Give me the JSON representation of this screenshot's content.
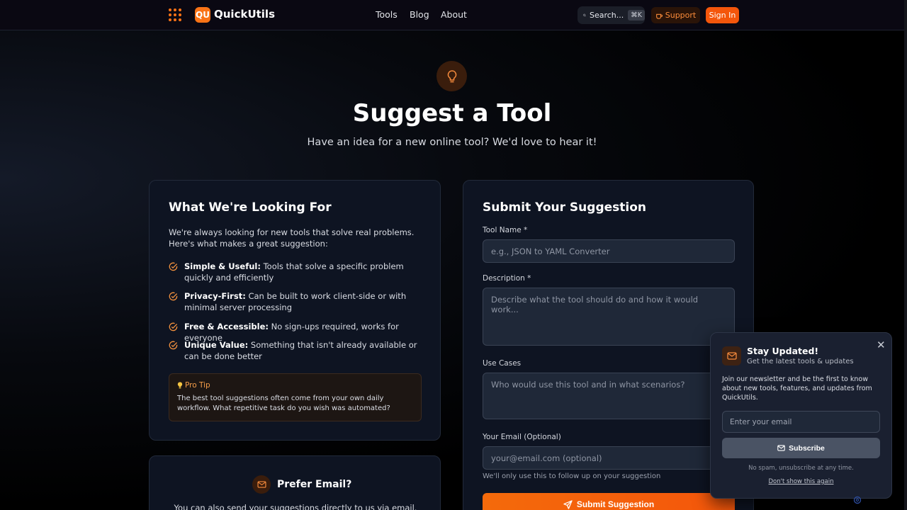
{
  "nav": {
    "brand": "QuickUtils",
    "logo_letter": "QU",
    "links": [
      "Tools",
      "Blog",
      "About"
    ],
    "search_label": "Search...",
    "search_shortcut": "⌘K",
    "support_label": "Support",
    "signin_label": "Sign In"
  },
  "hero": {
    "title": "Suggest a Tool",
    "subtitle": "Have an idea for a new online tool? We'd love to hear it!"
  },
  "looking_for": {
    "title": "What We're Looking For",
    "intro": "We're always looking for new tools that solve real problems. Here's what makes a great suggestion:",
    "criteria": [
      {
        "name": "Simple & Useful:",
        "text": " Tools that solve a specific problem quickly and efficiently"
      },
      {
        "name": "Privacy-First:",
        "text": " Can be built to work client-side or with minimal server processing"
      },
      {
        "name": "Free & Accessible:",
        "text": " No sign-ups required, works for everyone"
      },
      {
        "name": "Unique Value:",
        "text": " Something that isn't already available or can be done better"
      }
    ],
    "tip_label": "Pro Tip",
    "tip_text": "The best tool suggestions often come from your own daily workflow. What repetitive task do you wish was automated?"
  },
  "form": {
    "title": "Submit Your Suggestion",
    "tool_name_label": "Tool Name *",
    "tool_name_placeholder": "e.g., JSON to YAML Converter",
    "description_label": "Description *",
    "description_placeholder": "Describe what the tool should do and how it would work...",
    "use_cases_label": "Use Cases",
    "use_cases_placeholder": "Who would use this tool and in what scenarios?",
    "email_label": "Your Email (Optional)",
    "email_placeholder": "your@email.com (optional)",
    "email_hint": "We'll only use this to follow up on your suggestion",
    "submit_label": "Submit Suggestion"
  },
  "prefer_email": {
    "title": "Prefer Email?",
    "text": "You can also send your suggestions directly to us via email."
  },
  "newsletter": {
    "title": "Stay Updated!",
    "subtitle": "Get the latest tools & updates",
    "body": "Join our newsletter and be the first to know about new tools, features, and updates from QuickUtils.",
    "input_placeholder": "Enter your email",
    "subscribe_label": "Subscribe",
    "note": "No spam, unsubscribe at any time.",
    "dismiss_label": "Don't show this again"
  },
  "colors": {
    "accent": "#f97316",
    "button": "#f4560b",
    "card_bg": "#0e1422",
    "popup_bg": "#1a2030"
  }
}
